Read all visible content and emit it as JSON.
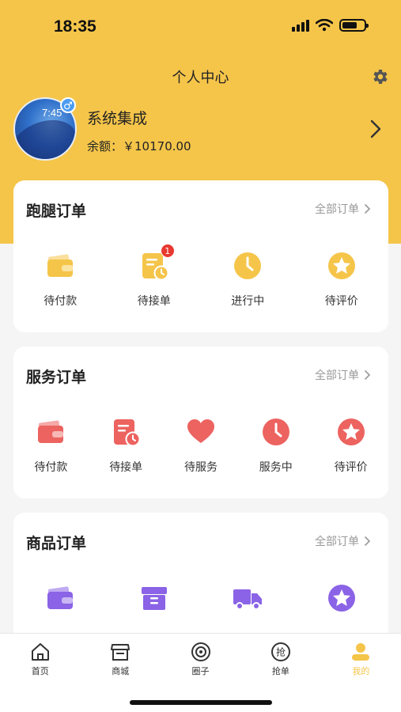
{
  "status_bar": {
    "time": "18:35"
  },
  "header": {
    "title": "个人中心"
  },
  "profile": {
    "name": "系统集成",
    "balance_label": "余额：",
    "balance_value": "￥10170.00",
    "avatar_clock": "7:45"
  },
  "colors": {
    "brand_yellow": "#f5c54a",
    "errand_icon": "#f5c54a",
    "service_icon": "#ec6360",
    "goods_icon": "#8a63e6",
    "badge_red": "#e8382f"
  },
  "orders": [
    {
      "title": "跑腿订单",
      "more": "全部订单",
      "items": [
        {
          "label": "待付款",
          "icon": "wallet-icon"
        },
        {
          "label": "待接单",
          "icon": "pending-order-icon",
          "badge": "1"
        },
        {
          "label": "进行中",
          "icon": "clock-icon"
        },
        {
          "label": "待评价",
          "icon": "star-icon"
        }
      ]
    },
    {
      "title": "服务订单",
      "more": "全部订单",
      "items": [
        {
          "label": "待付款",
          "icon": "wallet-icon"
        },
        {
          "label": "待接单",
          "icon": "pending-order-icon"
        },
        {
          "label": "待服务",
          "icon": "heart-icon"
        },
        {
          "label": "服务中",
          "icon": "clock-icon"
        },
        {
          "label": "待评价",
          "icon": "star-icon"
        }
      ]
    },
    {
      "title": "商品订单",
      "more": "全部订单",
      "items": [
        {
          "label": "",
          "icon": "wallet-icon"
        },
        {
          "label": "",
          "icon": "box-icon"
        },
        {
          "label": "",
          "icon": "truck-icon"
        },
        {
          "label": "",
          "icon": "star-icon"
        }
      ]
    }
  ],
  "tabbar": [
    {
      "label": "首页",
      "icon": "home-icon"
    },
    {
      "label": "商城",
      "icon": "shop-icon"
    },
    {
      "label": "圈子",
      "icon": "circle-icon"
    },
    {
      "label": "抢单",
      "icon": "grab-order-icon"
    },
    {
      "label": "我的",
      "icon": "profile-icon",
      "active": true
    }
  ]
}
